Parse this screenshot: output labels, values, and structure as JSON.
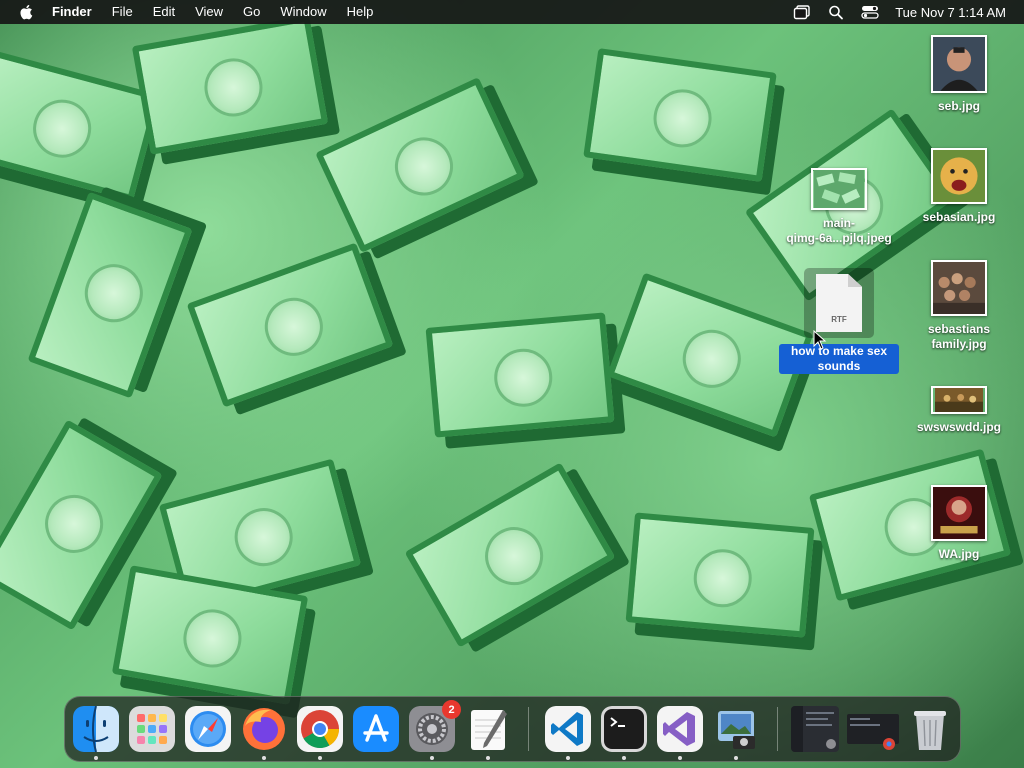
{
  "menubar": {
    "app_name": "Finder",
    "menus": [
      "File",
      "Edit",
      "View",
      "Go",
      "Window",
      "Help"
    ],
    "clock": "Tue Nov 7  1:14 AM"
  },
  "desktop": {
    "files": [
      {
        "label": "seb.jpg"
      },
      {
        "label": "sebasian.jpg"
      },
      {
        "label": "main-\nqimg-6a...pjlq.jpeg"
      },
      {
        "label": "how to make sex sounds",
        "kind_text": "RTF",
        "selected": true
      },
      {
        "label": "sebastians family.jpg"
      },
      {
        "label": "swswswdd.jpg"
      },
      {
        "label": "WA.jpg"
      }
    ]
  },
  "dock": {
    "apps": [
      {
        "icon": "finder-icon",
        "running": true
      },
      {
        "icon": "launchpad-icon",
        "running": false
      },
      {
        "icon": "safari-icon",
        "running": false
      },
      {
        "icon": "firefox-icon",
        "running": true
      },
      {
        "icon": "chrome-icon",
        "running": true
      },
      {
        "icon": "app-store-icon",
        "running": false
      },
      {
        "icon": "system-settings-icon",
        "running": true,
        "badge": "2"
      },
      {
        "icon": "textedit-icon",
        "running": true
      },
      {
        "icon": "vscode-icon",
        "running": true
      },
      {
        "icon": "terminal-icon",
        "running": true
      },
      {
        "icon": "visual-studio-icon",
        "running": true
      },
      {
        "icon": "preview-icon",
        "running": true
      },
      {
        "icon": "minimized-window-1-icon",
        "running": false
      },
      {
        "icon": "minimized-window-2-icon",
        "running": false
      },
      {
        "icon": "trash-icon",
        "running": false
      }
    ]
  },
  "colors": {
    "menubar_bg": "#161616",
    "selection_blue": "#1560d4",
    "badge_red": "#e8382e",
    "wallpaper_green": "#5aa56a"
  }
}
